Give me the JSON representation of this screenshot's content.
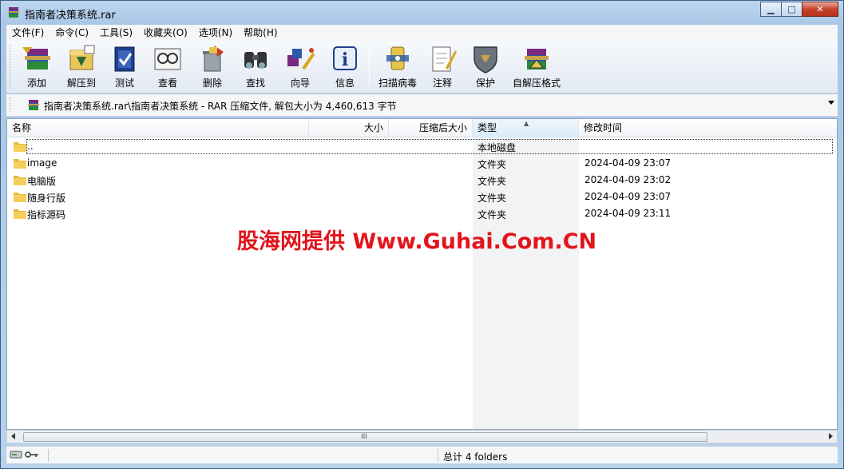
{
  "window": {
    "title": "指南者决策系统.rar"
  },
  "menu": [
    "文件(F)",
    "命令(C)",
    "工具(S)",
    "收藏夹(O)",
    "选项(N)",
    "帮助(H)"
  ],
  "toolbar": [
    {
      "label": "添加",
      "icon": "add-archive-icon"
    },
    {
      "label": "解压到",
      "icon": "extract-to-icon"
    },
    {
      "label": "测试",
      "icon": "test-icon"
    },
    {
      "label": "查看",
      "icon": "view-icon"
    },
    {
      "label": "删除",
      "icon": "delete-icon"
    },
    {
      "label": "查找",
      "icon": "find-icon"
    },
    {
      "label": "向导",
      "icon": "wizard-icon"
    },
    {
      "label": "信息",
      "icon": "info-icon"
    },
    {
      "label": "扫描病毒",
      "icon": "virus-scan-icon"
    },
    {
      "label": "注释",
      "icon": "comment-icon"
    },
    {
      "label": "保护",
      "icon": "protect-icon"
    },
    {
      "label": "自解压格式",
      "icon": "sfx-icon"
    }
  ],
  "address": {
    "text": "指南者决策系统.rar\\指南者决策系统 - RAR 压缩文件, 解包大小为 4,460,613 字节"
  },
  "columns": {
    "name": "名称",
    "size": "大小",
    "packed": "压缩后大小",
    "type": "类型",
    "modified": "修改时间"
  },
  "files": [
    {
      "name": "..",
      "type": "本地磁盘",
      "modified": ""
    },
    {
      "name": "image",
      "type": "文件夹",
      "modified": "2024-04-09 23:07"
    },
    {
      "name": "电脑版",
      "type": "文件夹",
      "modified": "2024-04-09 23:02"
    },
    {
      "name": "随身行版",
      "type": "文件夹",
      "modified": "2024-04-09 23:07"
    },
    {
      "name": "指标源码",
      "type": "文件夹",
      "modified": "2024-04-09 23:11"
    }
  ],
  "watermark": "股海网提供 Www.Guhai.Com.CN",
  "status": {
    "summary": "总计 4 folders"
  },
  "scrollbar": {
    "grip": "III"
  },
  "colors": {
    "watermark": "#e2141c",
    "folder": "#e8b83a"
  }
}
